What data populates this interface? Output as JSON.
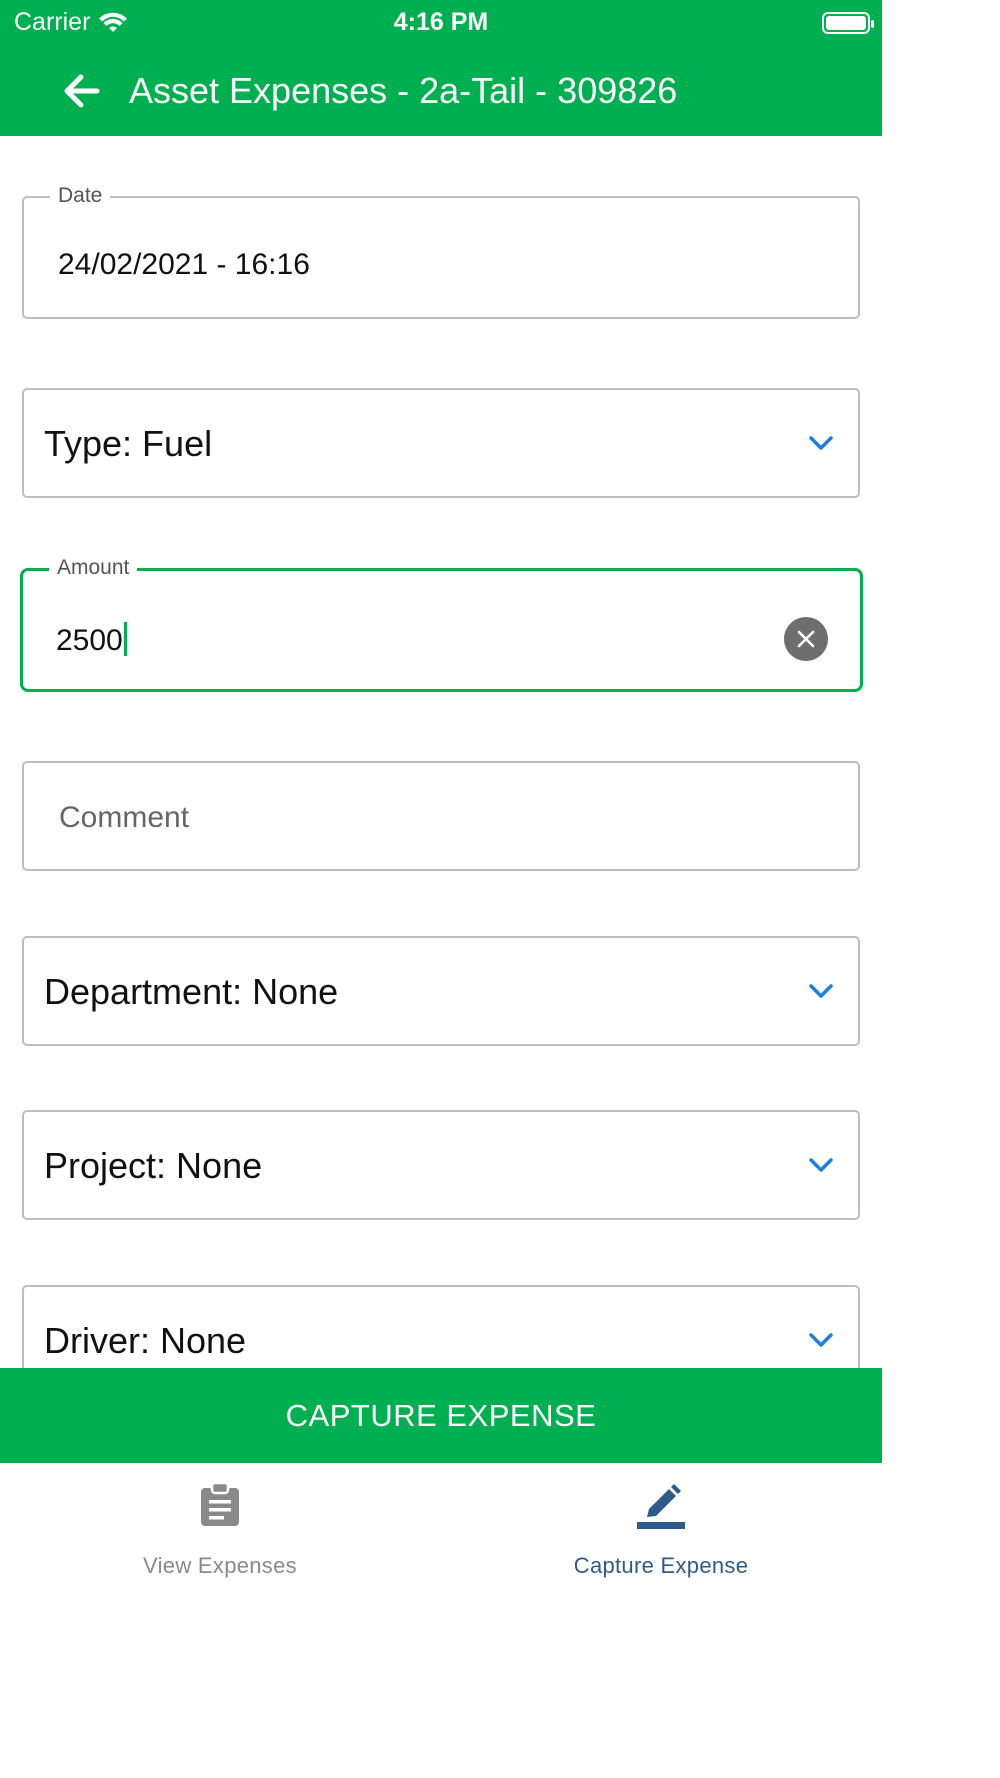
{
  "status_bar": {
    "carrier": "Carrier",
    "time": "4:16 PM"
  },
  "header": {
    "title": "Asset Expenses - 2a-Tail - 309826",
    "back_icon": "arrow-left-icon"
  },
  "form": {
    "date": {
      "label": "Date",
      "value": "24/02/2021 - 16:16"
    },
    "type": {
      "label": "Type: Fuel"
    },
    "amount": {
      "label": "Amount",
      "value": "2500"
    },
    "comment": {
      "placeholder": "Comment"
    },
    "department": {
      "label": "Department: None"
    },
    "project": {
      "label": "Project: None"
    },
    "driver": {
      "label": "Driver: None"
    }
  },
  "capture_button": {
    "label": "CAPTURE EXPENSE"
  },
  "tabs": [
    {
      "label": "View Expenses",
      "icon": "clipboard-icon",
      "active": false
    },
    {
      "label": "Capture Expense",
      "icon": "pencil-icon",
      "active": true
    }
  ],
  "colors": {
    "primary": "#00b050",
    "chevron": "#1a7fe0",
    "active_tab": "#2e5c8a",
    "inactive_tab": "#8a8a8a"
  }
}
